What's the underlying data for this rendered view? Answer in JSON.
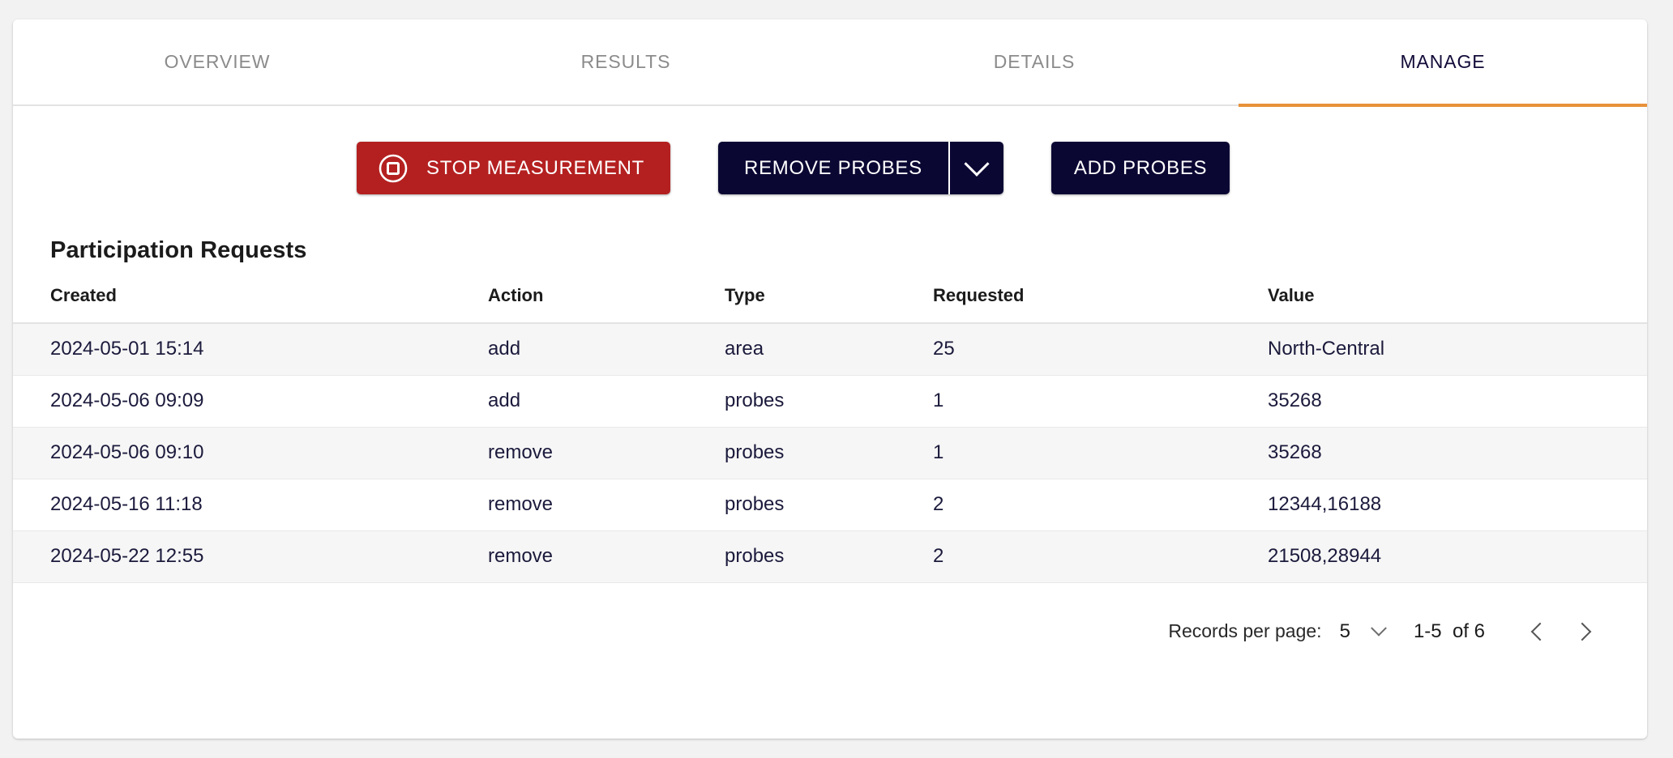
{
  "tabs": [
    {
      "label": "OVERVIEW",
      "active": false
    },
    {
      "label": "RESULTS",
      "active": false
    },
    {
      "label": "DETAILS",
      "active": false
    },
    {
      "label": "MANAGE",
      "active": true
    }
  ],
  "toolbar": {
    "stop_measurement_label": "STOP MEASUREMENT",
    "stop_icon": "stop-circle-icon",
    "remove_probes_label": "REMOVE PROBES",
    "remove_probes_caret_icon": "chevron-down-icon",
    "add_probes_label": "ADD PROBES"
  },
  "section": {
    "title": "Participation Requests"
  },
  "table": {
    "columns": [
      "Created",
      "Action",
      "Type",
      "Requested",
      "Value"
    ],
    "rows": [
      {
        "created": "2024-05-01 15:14",
        "action": "add",
        "type": "area",
        "requested": "25",
        "value": "North-Central"
      },
      {
        "created": "2024-05-06 09:09",
        "action": "add",
        "type": "probes",
        "requested": "1",
        "value": "35268"
      },
      {
        "created": "2024-05-06 09:10",
        "action": "remove",
        "type": "probes",
        "requested": "1",
        "value": "35268"
      },
      {
        "created": "2024-05-16 11:18",
        "action": "remove",
        "type": "probes",
        "requested": "2",
        "value": "12344,16188"
      },
      {
        "created": "2024-05-22 12:55",
        "action": "remove",
        "type": "probes",
        "requested": "2",
        "value": "21508,28944"
      }
    ]
  },
  "pagination": {
    "records_per_page_label": "Records per page:",
    "records_per_page_value": "5",
    "records_per_page_caret_icon": "chevron-down-icon",
    "range_text": "1-5  of 6",
    "prev_icon": "chevron-left-icon",
    "next_icon": "chevron-right-icon"
  },
  "colors": {
    "page_background": "#f2f2f2",
    "card_background": "#ffffff",
    "accent_orange": "#e8913a",
    "danger_red": "#b42020",
    "dark_navy": "#0b0733",
    "tab_inactive": "#8b8b8b",
    "row_stripe": "#f6f6f6"
  }
}
